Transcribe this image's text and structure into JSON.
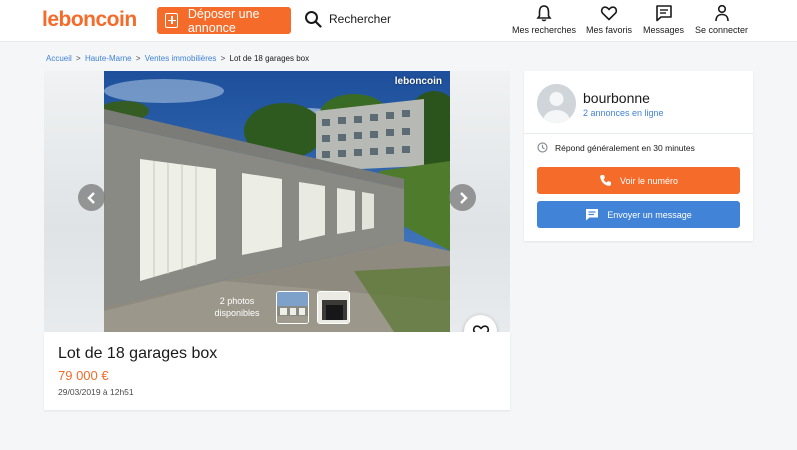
{
  "header": {
    "logo": "leboncoin",
    "post_button": "Déposer une annonce",
    "search_label": "Rechercher",
    "nav": [
      {
        "label": "Mes recherches",
        "icon": "bell-icon"
      },
      {
        "label": "Mes favoris",
        "icon": "heart-icon"
      },
      {
        "label": "Messages",
        "icon": "message-icon"
      },
      {
        "label": "Se connecter",
        "icon": "user-icon"
      }
    ]
  },
  "breadcrumb": {
    "items": [
      "Accueil",
      "Haute-Marne",
      "Ventes immobilières"
    ],
    "separator": ">",
    "current": "Lot de 18 garages box"
  },
  "gallery": {
    "watermark": "leboncoin",
    "photo_count_line1": "2 photos",
    "photo_count_line2": "disponibles",
    "thumbnails": 2
  },
  "listing": {
    "title": "Lot de 18 garages box",
    "price": "79 000 €",
    "date": "29/03/2019 à 12h51"
  },
  "seller": {
    "name": "bourbonne",
    "ads_link": "2 annonces en ligne",
    "response_time": "Répond généralement en 30 minutes",
    "call_button": "Voir le numéro",
    "message_button": "Envoyer un message"
  },
  "colors": {
    "brand_orange": "#f56b2a",
    "link_blue": "#4183d7",
    "background": "#f4f6f7"
  }
}
